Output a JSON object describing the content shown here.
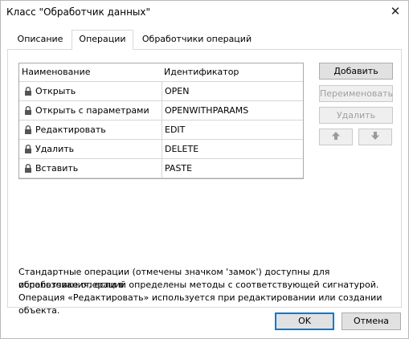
{
  "window": {
    "title": "Класс \"Обработчик данных\""
  },
  "tabs": [
    {
      "label": "Описание",
      "active": false
    },
    {
      "label": "Операции",
      "active": true
    },
    {
      "label": "Обработчики операций",
      "active": false
    }
  ],
  "table": {
    "headers": [
      "Наименование",
      "Идентификатор"
    ],
    "rows": [
      {
        "name": "Открыть",
        "id": "OPEN",
        "locked": true
      },
      {
        "name": "Открыть с параметрами",
        "id": "OPENWITHPARAMS",
        "locked": true
      },
      {
        "name": "Редактировать",
        "id": "EDIT",
        "locked": true
      },
      {
        "name": "Удалить",
        "id": "DELETE",
        "locked": true
      },
      {
        "name": "Вставить",
        "id": "PASTE",
        "locked": true
      }
    ]
  },
  "buttons": {
    "add": "Добавить",
    "rename": "Переименовать",
    "delete": "Удалить",
    "move_up_icon": "arrow-up-icon",
    "move_down_icon": "arrow-down-icon"
  },
  "info": {
    "line1": "Стандартные операции (отмечены значком 'замок') доступны для использования, если в",
    "line2": "обработчике операций определены методы с соответствующей сигнатурой.",
    "line3": "Операция «Редактировать» используется при редактировании или создании объекта."
  },
  "footer": {
    "ok": "OK",
    "cancel": "Отмена"
  },
  "colors": {
    "accent": "#0078d7",
    "disabled_text": "#a0a0a0"
  }
}
